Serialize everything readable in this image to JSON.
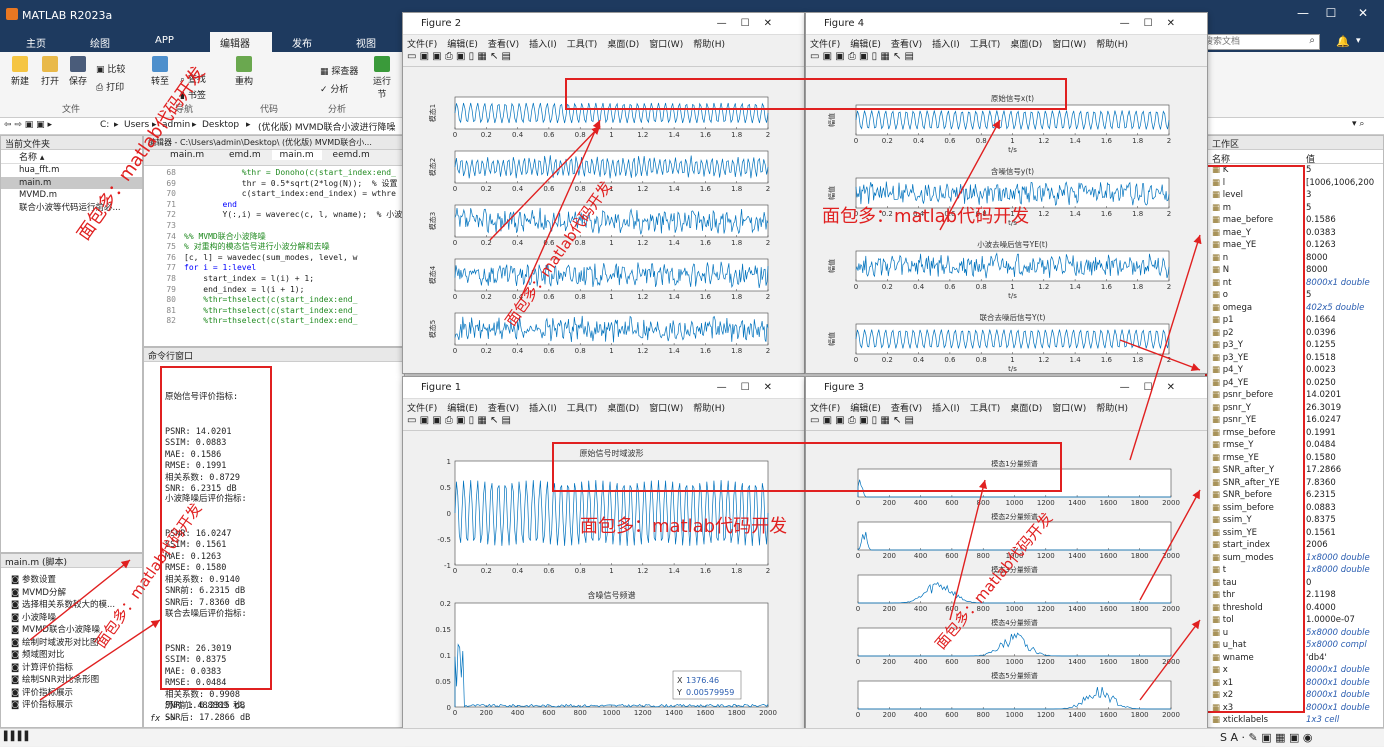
{
  "app": {
    "title": "MATLAB R2023a",
    "search_placeholder": "搜索文档"
  },
  "ribbon": {
    "tabs": [
      "主页",
      "绘图",
      "APP",
      "编辑器",
      "发布",
      "视图"
    ],
    "active_tab": "编辑器",
    "buttons": {
      "new": "新建",
      "open": "打开",
      "save": "保存",
      "compare": "比较",
      "print": "打印",
      "goto": "转至",
      "find": "查找",
      "bookmark": "书签",
      "refactor": "重构",
      "explore": "探查器",
      "analyze": "分析",
      "run": "运行节"
    },
    "groups": [
      "文件",
      "导航",
      "代码",
      "分析"
    ]
  },
  "address": {
    "path": [
      "C:",
      "Users",
      "admin",
      "Desktop",
      "(优化版) MVMD联合小波进行降噪"
    ]
  },
  "current_folder": {
    "title": "当前文件夹",
    "col": "名称",
    "files": [
      "hua_fft.m",
      "main.m",
      "MVMD.m",
      "联合小波等代码运行前必..."
    ],
    "selected": "main.m"
  },
  "details": {
    "title": "main.m (脚本)",
    "items": [
      "参数设置",
      "MVMD分解",
      "选择相关系数较大的模...",
      "小波降噪",
      "MVMD联合小波降噪",
      "绘制时域波形对比图",
      "频域图对比",
      "计算评价指标",
      "绘制SNR对比条形图",
      "评价指标展示",
      "评价指标展示"
    ]
  },
  "editor": {
    "title": "编辑器 - C:\\Users\\admin\\Desktop\\ (优化版) MVMD联合小...",
    "tabs": [
      "main.m",
      "emd.m",
      "main.m",
      "eemd.m"
    ],
    "lines": [
      {
        "n": "68",
        "t": "            %thr = Donoho(c(start_index:end_"
      },
      {
        "n": "69",
        "t": "            thr = 0.5*sqrt(2*log(N));  % 设置"
      },
      {
        "n": "70",
        "t": "            c(start_index:end_index) = wthre"
      },
      {
        "n": "71",
        "t": "        end"
      },
      {
        "n": "72",
        "t": "        Y(:,i) = waverec(c, l, wname);  % 小波重"
      },
      {
        "n": "73",
        "t": ""
      },
      {
        "n": "74",
        "t": "%% MVMD联合小波降噪"
      },
      {
        "n": "75",
        "t": "% 对重构的模态信号进行小波分解和去噪"
      },
      {
        "n": "76",
        "t": "[c, l] = wavedec(sum_modes, level, w"
      },
      {
        "n": "77",
        "t": "for i = 1:level"
      },
      {
        "n": "78",
        "t": "    start_index = l(i) + 1;"
      },
      {
        "n": "79",
        "t": "    end_index = l(i + 1);"
      },
      {
        "n": "80",
        "t": "    %thr=thselect(c(start_index:end_"
      },
      {
        "n": "81",
        "t": "    %thr=thselect(c(start_index:end_"
      },
      {
        "n": "82",
        "t": "    %thr=thselect(c(start_index:end_"
      }
    ]
  },
  "command": {
    "title": "命令行窗口",
    "block1": {
      "header": "原始信号评价指标:",
      "lines": [
        "PSNR: 14.0201",
        "SSIM: 0.0883",
        "MAE: 0.1586",
        "RMSE: 0.1991",
        "相关系数: 0.8729",
        "SNR: 6.2315 dB"
      ]
    },
    "block2": {
      "header": "小波降噪后评价指标:",
      "lines": [
        "PSNR: 16.0247",
        "SSIM: 0.1561",
        "MAE: 0.1263",
        "RMSE: 0.1580",
        "相关系数: 0.9140",
        "SNR前: 6.2315 dB",
        "SNR后: 7.8360 dB"
      ]
    },
    "block3": {
      "header": "联合去噪后评价指标:",
      "lines": [
        "PSNR: 26.3019",
        "SSIM: 0.8375",
        "MAE: 0.0383",
        "RMSE: 0.0484",
        "相关系数: 0.9908",
        "SNR前: 6.2315 dB",
        "SNR后: 17.2866 dB"
      ]
    },
    "elapsed": "历时 1.488809 秒。",
    "prompt": ">>"
  },
  "workspace": {
    "title": "工作区",
    "col_name": "名称",
    "col_value": "值",
    "vars": [
      [
        "K",
        "5"
      ],
      [
        "l",
        "[1006,1006,200"
      ],
      [
        "level",
        "3"
      ],
      [
        "m",
        "5"
      ],
      [
        "mae_before",
        "0.1586"
      ],
      [
        "mae_Y",
        "0.0383"
      ],
      [
        "mae_YE",
        "0.1263"
      ],
      [
        "n",
        "8000"
      ],
      [
        "N",
        "8000"
      ],
      [
        "nt",
        "8000x1 double"
      ],
      [
        "o",
        "5"
      ],
      [
        "omega",
        "402x5 double"
      ],
      [
        "p1",
        "0.1664"
      ],
      [
        "p2",
        "0.0396"
      ],
      [
        "p3_Y",
        "0.1255"
      ],
      [
        "p3_YE",
        "0.1518"
      ],
      [
        "p4_Y",
        "0.0023"
      ],
      [
        "p4_YE",
        "0.0250"
      ],
      [
        "psnr_before",
        "14.0201"
      ],
      [
        "psnr_Y",
        "26.3019"
      ],
      [
        "psnr_YE",
        "16.0247"
      ],
      [
        "rmse_before",
        "0.1991"
      ],
      [
        "rmse_Y",
        "0.0484"
      ],
      [
        "rmse_YE",
        "0.1580"
      ],
      [
        "SNR_after_Y",
        "17.2866"
      ],
      [
        "SNR_after_YE",
        "7.8360"
      ],
      [
        "SNR_before",
        "6.2315"
      ],
      [
        "ssim_before",
        "0.0883"
      ],
      [
        "ssim_Y",
        "0.8375"
      ],
      [
        "ssim_YE",
        "0.1561"
      ],
      [
        "start_index",
        "2006"
      ],
      [
        "sum_modes",
        "1x8000 double"
      ],
      [
        "t",
        "1x8000 double"
      ],
      [
        "tau",
        "0"
      ],
      [
        "thr",
        "2.1198"
      ],
      [
        "threshold",
        "0.4000"
      ],
      [
        "tol",
        "1.0000e-07"
      ],
      [
        "u",
        "5x8000 double"
      ],
      [
        "u_hat",
        "5x8000 compl"
      ],
      [
        "wname",
        "'db4'"
      ],
      [
        "x",
        "8000x1 double"
      ],
      [
        "x1",
        "8000x1 double"
      ],
      [
        "x2",
        "8000x1 double"
      ],
      [
        "x3",
        "8000x1 double"
      ],
      [
        "xticklabels",
        "1x3 cell"
      ]
    ]
  },
  "figure_menu": [
    "文件(F)",
    "编辑(E)",
    "查看(V)",
    "插入(I)",
    "工具(T)",
    "桌面(D)",
    "窗口(W)",
    "帮助(H)"
  ],
  "fig2": {
    "title": "Figure 2",
    "ylabels": [
      "模态1",
      "模态2",
      "模态3",
      "模态4",
      "模态5"
    ],
    "xticks": [
      "0",
      "0.2",
      "0.4",
      "0.6",
      "0.8",
      "1",
      "1.2",
      "1.4",
      "1.6",
      "1.8",
      "2"
    ]
  },
  "fig4": {
    "title": "Figure 4",
    "subtitles": [
      "原始信号x(t)",
      "含噪信号y(t)",
      "小波去噪后信号YE(t)",
      "联合去噪后信号Y(t)"
    ],
    "ylabel": "幅值",
    "xlabel": "t/s",
    "xticks": [
      "0",
      "0.2",
      "0.4",
      "0.6",
      "0.8",
      "1",
      "1.2",
      "1.4",
      "1.6",
      "1.8",
      "2"
    ]
  },
  "fig1": {
    "title": "Figure 1",
    "top_title": "原始信号时域波形",
    "bottom_title": "含噪信号频谱",
    "top_yticks": [
      "1",
      "0.5",
      "0",
      "-0.5",
      "-1"
    ],
    "top_xticks": [
      "0",
      "0.2",
      "0.4",
      "0.6",
      "0.8",
      "1",
      "1.2",
      "1.4",
      "1.6",
      "1.8",
      "2"
    ],
    "bottom_yticks": [
      "0.2",
      "0.15",
      "0.1",
      "0.05",
      "0"
    ],
    "bottom_xticks": [
      "0",
      "200",
      "400",
      "600",
      "800",
      "1000",
      "1200",
      "1400",
      "1600",
      "1800",
      "2000"
    ],
    "datatip": {
      "x": "1376.46",
      "y": "0.00579959"
    }
  },
  "fig3": {
    "title": "Figure 3",
    "subtitles": [
      "模态1分量频谱",
      "模态2分量频谱",
      "模态3分量频谱",
      "模态4分量频谱",
      "模态5分量频谱"
    ],
    "xticks": [
      "0",
      "200",
      "400",
      "600",
      "800",
      "1000",
      "1200",
      "1400",
      "1600",
      "1800",
      "2000"
    ]
  },
  "annotations": {
    "watermark": "面包多：matlab代码开发"
  },
  "colors": {
    "signal": "#0072bd",
    "annotation": "#e02020",
    "titlebar": "#1e3a5f"
  }
}
